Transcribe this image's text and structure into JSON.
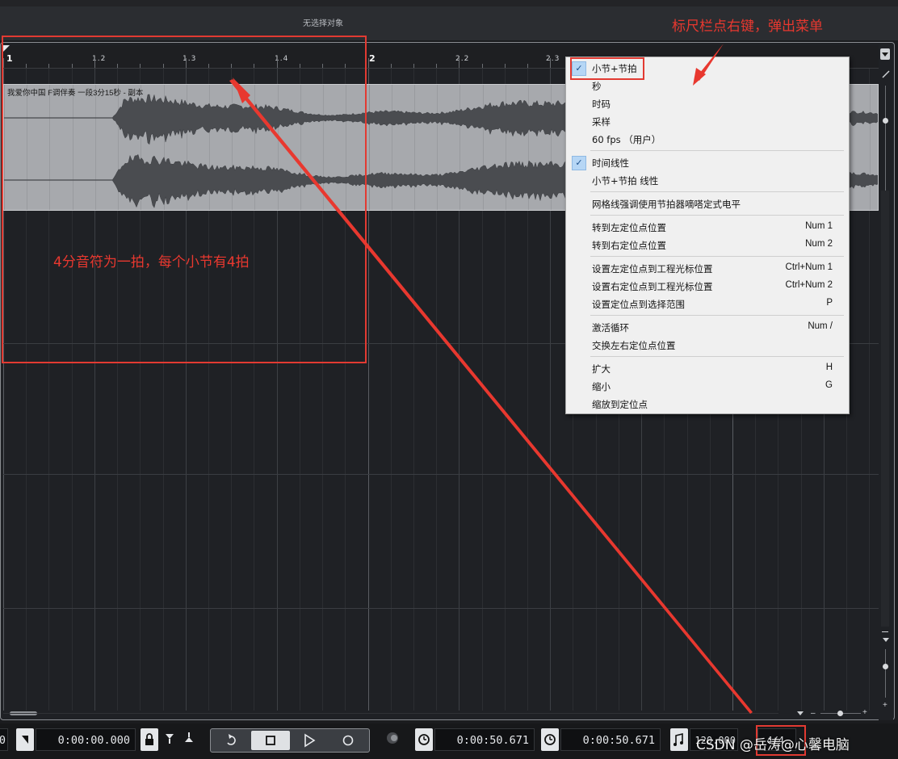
{
  "info_bar": {
    "title": "无选择对象"
  },
  "ruler": {
    "labels": [
      "1",
      "1.2",
      "1.3",
      "1.4",
      "2",
      "2.2",
      "2.3"
    ]
  },
  "clip": {
    "title": "我爱你中国 F调伴奏 一段3分15秒 - 副本"
  },
  "context_menu": {
    "items": [
      {
        "label": "小节+节拍",
        "shortcut": "",
        "checked": true
      },
      {
        "label": "秒",
        "shortcut": "",
        "checked": false
      },
      {
        "label": "时码",
        "shortcut": "",
        "checked": false
      },
      {
        "label": "采样",
        "shortcut": "",
        "checked": false
      },
      {
        "label": "60 fps （用户）",
        "shortcut": "",
        "checked": false
      },
      {
        "label": "时间线性",
        "shortcut": "",
        "checked": true
      },
      {
        "label": "小节+节拍 线性",
        "shortcut": "",
        "checked": false
      },
      {
        "label": "网格线强调使用节拍器嘀嗒定式电平",
        "shortcut": "",
        "checked": false
      },
      {
        "label": "转到左定位点位置",
        "shortcut": "Num 1",
        "checked": false
      },
      {
        "label": "转到右定位点位置",
        "shortcut": "Num 2",
        "checked": false
      },
      {
        "label": "设置左定位点到工程光标位置",
        "shortcut": "Ctrl+Num 1",
        "checked": false
      },
      {
        "label": "设置右定位点到工程光标位置",
        "shortcut": "Ctrl+Num 2",
        "checked": false
      },
      {
        "label": "设置定位点到选择范围",
        "shortcut": "P",
        "checked": false
      },
      {
        "label": "激活循环",
        "shortcut": "Num /",
        "checked": false
      },
      {
        "label": "交换左右定位点位置",
        "shortcut": "",
        "checked": false
      },
      {
        "label": "扩大",
        "shortcut": "H",
        "checked": false
      },
      {
        "label": "缩小",
        "shortcut": "G",
        "checked": false
      },
      {
        "label": "缩放到定位点",
        "shortcut": "",
        "checked": false
      }
    ]
  },
  "annotations": {
    "top_right_note": "标尺栏点右键，弹出菜单",
    "beat_note": "4分音符为一拍，每个小节有4拍"
  },
  "transport": {
    "left_edge_digit": "0",
    "left_locator_time": "0:00:00.000",
    "primary_time": "0:00:50.671",
    "secondary_time": "0:00:50.671",
    "tempo": "120.000",
    "signature": "4/4"
  },
  "watermark": "CSDN @岳涛@心馨电脑",
  "colors": {
    "annotation_red": "#e8382f",
    "menu_check_bg": "#b6d6f5",
    "clip_bg": "#a7a9ad",
    "waveform": "#4a4c50"
  }
}
